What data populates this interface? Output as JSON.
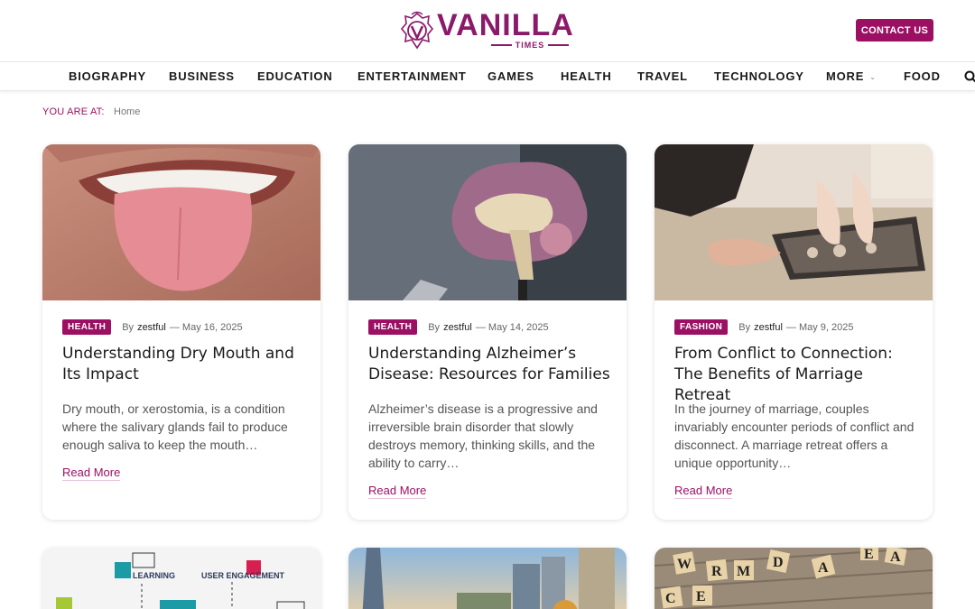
{
  "brand": {
    "name": "VANILLA",
    "subtitle": "TIMES",
    "color": "#8b1a6b"
  },
  "header": {
    "contact_label": "CONTACT US",
    "accent": "#9c1063"
  },
  "nav": {
    "items": [
      "BIOGRAPHY",
      "BUSINESS",
      "EDUCATION",
      "ENTERTAINMENT",
      "GAMES",
      "HEALTH",
      "TRAVEL",
      "TECHNOLOGY",
      "MORE",
      "FOOD"
    ],
    "search_icon": "search-icon"
  },
  "breadcrumb": {
    "label": "YOU ARE AT:",
    "home": "Home"
  },
  "posts": [
    {
      "category": "HEALTH",
      "by": "By",
      "author": "zestful",
      "date": "— May 16, 2025",
      "title": "Understanding Dry Mouth and Its Impact",
      "excerpt": "Dry mouth, or xerostomia, is a condition where the salivary glands fail to produce enough saliva to keep the mouth…",
      "read_more": "Read More",
      "image": "mouth-tongue-photo"
    },
    {
      "category": "HEALTH",
      "by": "By",
      "author": "zestful",
      "date": "— May 14, 2025",
      "title": "Understanding Alzheimer’s Disease: Resources for Families",
      "excerpt": "Alzheimer’s disease is a progressive and irreversible brain disorder that slowly destroys memory, thinking skills, and the ability to carry…",
      "read_more": "Read More",
      "image": "brain-model-photo"
    },
    {
      "category": "FASHION",
      "by": "By",
      "author": "zestful",
      "date": "— May 9, 2025",
      "title": "From Conflict to Connection: The Benefits of Marriage Retreat",
      "excerpt": "In the journey of marriage, couples invariably encounter periods of conflict and disconnect. A marriage retreat offers a unique opportunity…",
      "read_more": "Read More",
      "image": "puzzle-hands-photo"
    }
  ],
  "lower_cards": {
    "labels": [
      "LEARNING",
      "USER ENGAGEMENT"
    ],
    "tiles": [
      "W",
      "R",
      "M",
      "D",
      "A",
      "E",
      "A",
      "C",
      "E"
    ]
  }
}
